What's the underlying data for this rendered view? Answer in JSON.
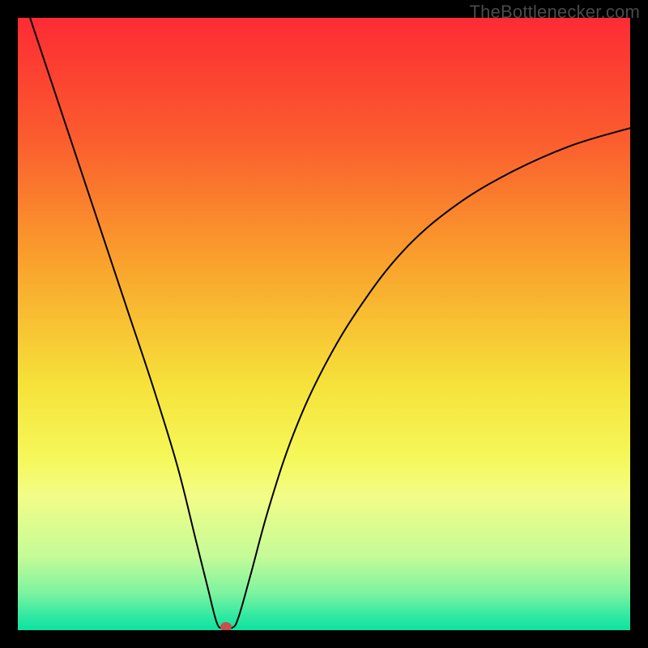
{
  "watermark": "TheBottlenecker.com",
  "colors": {
    "frame": "#000000",
    "curve": "#000000",
    "marker": "#c94f4a",
    "gradient_stops": [
      {
        "offset": 0.0,
        "color": "#fd2b34"
      },
      {
        "offset": 0.2,
        "color": "#fb5d2e"
      },
      {
        "offset": 0.4,
        "color": "#f9a22c"
      },
      {
        "offset": 0.6,
        "color": "#f6e23a"
      },
      {
        "offset": 0.72,
        "color": "#f5f85a"
      },
      {
        "offset": 0.78,
        "color": "#f3fd87"
      },
      {
        "offset": 0.88,
        "color": "#c4fb98"
      },
      {
        "offset": 0.94,
        "color": "#7cf3a0"
      },
      {
        "offset": 0.975,
        "color": "#34e9a2"
      },
      {
        "offset": 1.0,
        "color": "#0be3a1"
      }
    ]
  },
  "chart_data": {
    "type": "line",
    "title": "",
    "xlabel": "",
    "ylabel": "",
    "xlim": [
      0,
      100
    ],
    "ylim": [
      0,
      100
    ],
    "min_point": {
      "x": 34,
      "y": 0
    },
    "series": [
      {
        "name": "bottleneck-curve",
        "points": [
          {
            "x": 2,
            "y": 100
          },
          {
            "x": 6,
            "y": 88
          },
          {
            "x": 10,
            "y": 76
          },
          {
            "x": 14,
            "y": 64
          },
          {
            "x": 18,
            "y": 52
          },
          {
            "x": 22,
            "y": 40
          },
          {
            "x": 26,
            "y": 27
          },
          {
            "x": 29,
            "y": 15
          },
          {
            "x": 31,
            "y": 7
          },
          {
            "x": 32.5,
            "y": 1.2
          },
          {
            "x": 33.5,
            "y": 0.4
          },
          {
            "x": 35,
            "y": 0.4
          },
          {
            "x": 36,
            "y": 2
          },
          {
            "x": 38,
            "y": 9
          },
          {
            "x": 41,
            "y": 20
          },
          {
            "x": 45,
            "y": 32
          },
          {
            "x": 50,
            "y": 43
          },
          {
            "x": 56,
            "y": 53
          },
          {
            "x": 63,
            "y": 62
          },
          {
            "x": 71,
            "y": 69
          },
          {
            "x": 80,
            "y": 74.5
          },
          {
            "x": 90,
            "y": 79
          },
          {
            "x": 100,
            "y": 82
          }
        ]
      }
    ]
  }
}
